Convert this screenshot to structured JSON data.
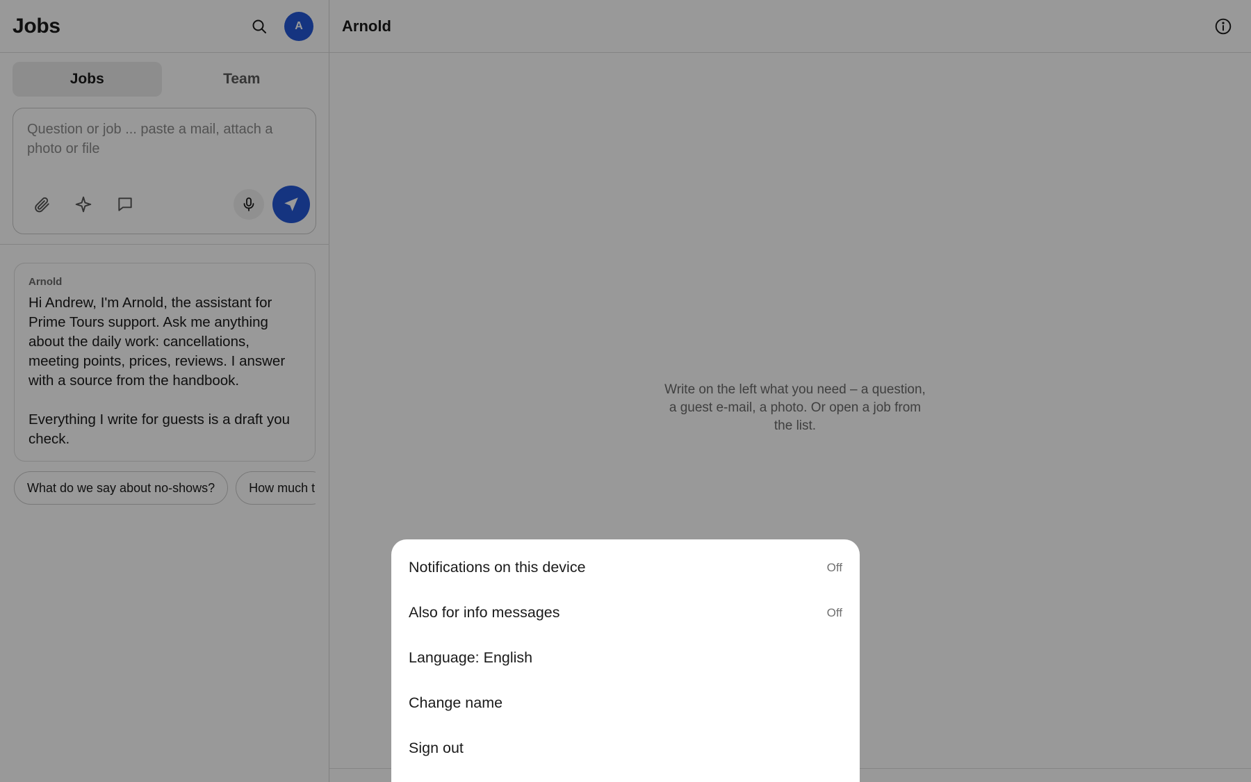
{
  "left_header": {
    "title": "Jobs",
    "avatar_initial": "A"
  },
  "tabs": [
    {
      "label": "Jobs",
      "active": true
    },
    {
      "label": "Team",
      "active": false
    }
  ],
  "composer": {
    "placeholder": "Question or job ... paste a mail, attach a photo or file"
  },
  "message": {
    "sender": "Arnold",
    "paragraphs": [
      "Hi Andrew, I'm Arnold, the assistant for Prime Tours support. Ask me anything about the daily work: cancellations, meeting points, prices, reviews. I answer with a source from the handbook.",
      "Everything I write for guests is a draft you check."
    ]
  },
  "chips": [
    "What do we say about no-shows?",
    "How much t"
  ],
  "right_header": {
    "title": "Arnold"
  },
  "empty_hint": "Write on the left what you need – a question, a guest e-mail, a photo. Or open a job from the list.",
  "settings_sheet": {
    "items": [
      {
        "label": "Notifications on this device",
        "value": "Off"
      },
      {
        "label": "Also for info messages",
        "value": "Off"
      },
      {
        "label": "Language: English",
        "value": ""
      },
      {
        "label": "Change name",
        "value": ""
      },
      {
        "label": "Sign out",
        "value": ""
      }
    ]
  },
  "colors": {
    "accent": "#2457d6",
    "overlay": "rgba(0,0,0,0.40)"
  }
}
